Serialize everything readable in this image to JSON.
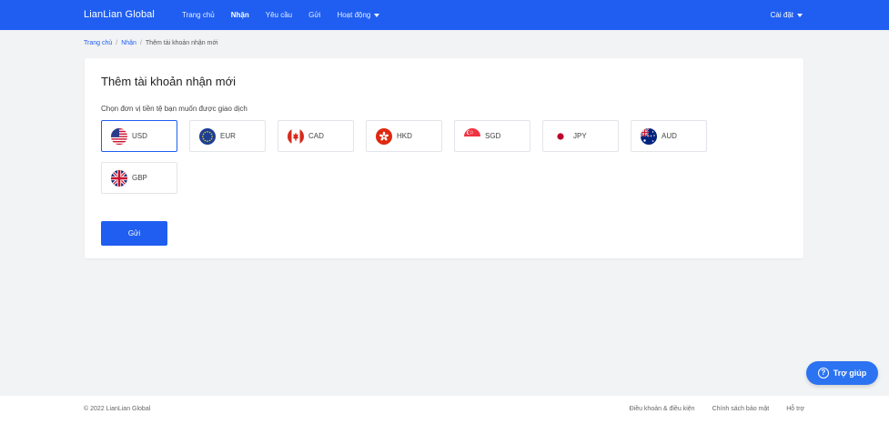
{
  "header": {
    "logo": "LianLian Global",
    "nav": [
      "Trang chủ",
      "Nhận",
      "Yêu cầu",
      "Gửi",
      "Hoạt động"
    ],
    "settings": "Cài đặt"
  },
  "breadcrumb": {
    "home": "Trang chủ",
    "receive": "Nhận",
    "current": "Thêm tài khoản nhận mới"
  },
  "card": {
    "title": "Thêm tài khoản nhận mới",
    "subtitle": "Chọn đơn vị tiền tệ bạn muốn được giao dịch",
    "currencies": [
      "USD",
      "EUR",
      "CAD",
      "HKD",
      "SGD",
      "JPY",
      "AUD",
      "GBP"
    ],
    "selected": "USD",
    "submit": "Gửi"
  },
  "help": {
    "label": "Trợ giúp"
  },
  "footer": {
    "copyright": "© 2022 LianLian Global",
    "links": [
      "Điều khoản & điều kiện",
      "Chính sách bảo mật",
      "Hỗ trợ"
    ]
  },
  "colors": {
    "brand": "#1f5ef0",
    "help_button": "#2b73f1",
    "background": "#f2f3f5"
  }
}
